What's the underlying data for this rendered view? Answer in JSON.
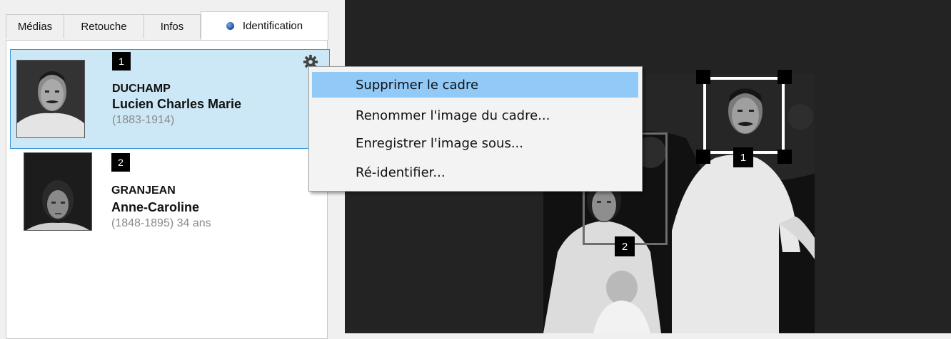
{
  "tabs": [
    {
      "label": "Médias"
    },
    {
      "label": "Retouche"
    },
    {
      "label": "Infos"
    },
    {
      "label": "Identification",
      "active": true
    }
  ],
  "persons": [
    {
      "number": "1",
      "surname": "DUCHAMP",
      "given_names": "Lucien Charles Marie",
      "dates": "(1883-1914)",
      "selected": true
    },
    {
      "number": "2",
      "surname": "GRANJEAN",
      "given_names": "Anne-Caroline",
      "dates": "(1848-1895) 34 ans",
      "selected": false
    }
  ],
  "context_menu": {
    "items": [
      {
        "label": "Supprimer le cadre",
        "highlighted": true
      },
      {
        "label": "Renommer l'image du cadre..."
      },
      {
        "label": "Enregistrer l'image sous..."
      },
      {
        "label": "Ré-identifier..."
      }
    ]
  },
  "viewer": {
    "frames": [
      {
        "label": "1",
        "selected": true
      },
      {
        "label": "2",
        "selected": false
      }
    ]
  },
  "colors": {
    "selection_bg": "#cce8f6",
    "selection_border": "#3a9ad9",
    "menu_highlight": "#91c9f7",
    "viewer_bg": "#232323"
  },
  "icons": {
    "gear": "gear-icon",
    "tab_status": "status-dot-icon"
  }
}
